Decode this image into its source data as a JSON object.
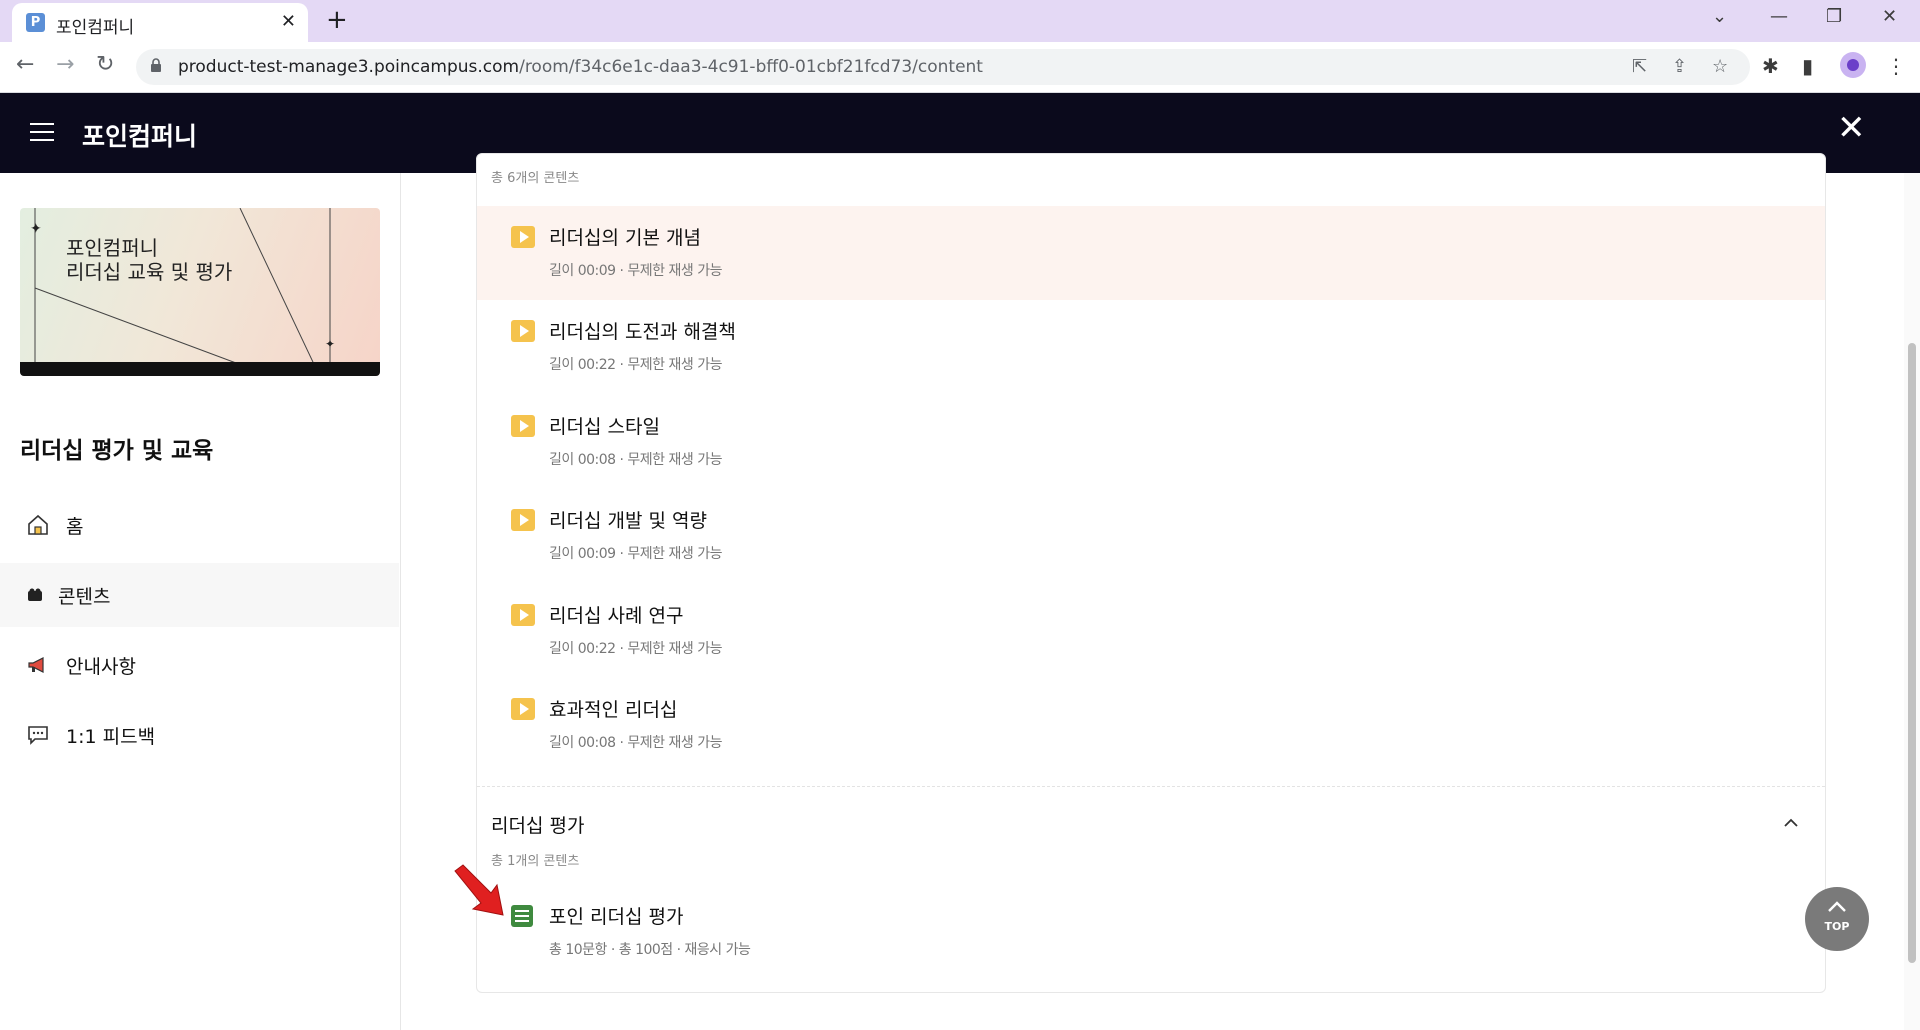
{
  "browser": {
    "tab_title": "포인컴퍼니",
    "favicon_letter": "P",
    "url_host": "product-test-manage3.poincampus.com",
    "url_path": "/room/f34c6e1c-daa3-4c91-bff0-01cbf21fcd73/content"
  },
  "header": {
    "brand": "포인컴퍼니"
  },
  "sidebar": {
    "thumbnail_line1": "포인컴퍼니",
    "thumbnail_line2": "리더십 교육 및 평가",
    "course_title": "리더십 평가 및 교육",
    "nav": [
      {
        "label": "홈",
        "icon": "home-icon"
      },
      {
        "label": "콘텐츠",
        "icon": "content-icon"
      },
      {
        "label": "안내사항",
        "icon": "megaphone-icon"
      },
      {
        "label": "1:1 피드백",
        "icon": "chat-icon"
      }
    ]
  },
  "content": {
    "section1_count": "총 6개의 콘텐츠",
    "items": [
      {
        "title": "리더십의 기본 개념",
        "meta": "길이 00:09 · 무제한 재생 가능"
      },
      {
        "title": "리더십의 도전과 해결책",
        "meta": "길이 00:22 · 무제한 재생 가능"
      },
      {
        "title": "리더십 스타일",
        "meta": "길이 00:08 · 무제한 재생 가능"
      },
      {
        "title": "리더십 개발 및 역량",
        "meta": "길이 00:09 · 무제한 재생 가능"
      },
      {
        "title": "리더십 사례 연구",
        "meta": "길이 00:22 · 무제한 재생 가능"
      },
      {
        "title": "효과적인 리더십",
        "meta": "길이 00:08 · 무제한 재생 가능"
      }
    ],
    "section2_title": "리더십 평가",
    "section2_count": "총 1개의 콘텐츠",
    "quiz": {
      "title": "포인 리더십 평가",
      "meta": "총 10문항 · 총 100점 ·  재응시 가능"
    },
    "top_button": "TOP"
  },
  "colors": {
    "header_bg": "#0b0a1c",
    "play_icon": "#f5c34d",
    "quiz_icon": "#3f8a3f",
    "highlight_row": "#fdf3ef",
    "annotation_arrow": "#e02020"
  }
}
